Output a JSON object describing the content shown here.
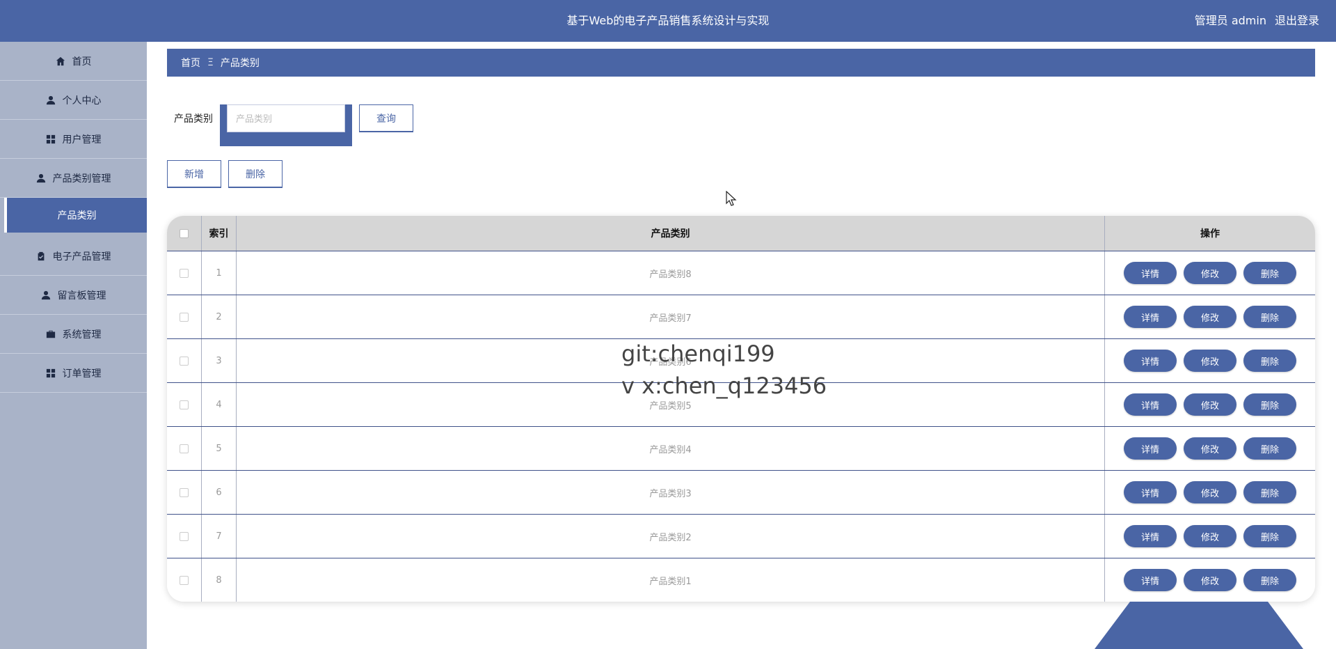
{
  "header": {
    "title": "基于Web的电子产品销售系统设计与实现",
    "user_label": "管理员 admin",
    "logout": "退出登录"
  },
  "sidebar": {
    "items": [
      {
        "label": "首页",
        "icon": "home-icon"
      },
      {
        "label": "个人中心",
        "icon": "user-icon"
      },
      {
        "label": "用户管理",
        "icon": "grid-icon"
      },
      {
        "label": "产品类别管理",
        "icon": "user-icon"
      },
      {
        "label": "产品类别",
        "icon": ""
      },
      {
        "label": "电子产品管理",
        "icon": "clipboard-icon"
      },
      {
        "label": "留言板管理",
        "icon": "user-icon"
      },
      {
        "label": "系统管理",
        "icon": "briefcase-icon"
      },
      {
        "label": "订单管理",
        "icon": "grid-icon"
      }
    ]
  },
  "breadcrumb": {
    "home": "首页",
    "separator": "Ξ",
    "current": "产品类别"
  },
  "search": {
    "label": "产品类别",
    "placeholder": "产品类别",
    "value": "",
    "query_button": "查询"
  },
  "actions": {
    "add": "新增",
    "delete": "删除"
  },
  "table": {
    "headers": {
      "index": "索引",
      "name": "产品类别",
      "op": "操作"
    },
    "rows": [
      {
        "index": "1",
        "name": "产品类别8"
      },
      {
        "index": "2",
        "name": "产品类别7"
      },
      {
        "index": "3",
        "name": "产品类别6"
      },
      {
        "index": "4",
        "name": "产品类别5"
      },
      {
        "index": "5",
        "name": "产品类别4"
      },
      {
        "index": "6",
        "name": "产品类别3"
      },
      {
        "index": "7",
        "name": "产品类别2"
      },
      {
        "index": "8",
        "name": "产品类别1"
      }
    ],
    "row_buttons": {
      "detail": "详情",
      "edit": "修改",
      "delete": "删除"
    }
  },
  "watermark": {
    "line1": "git:chenqi199",
    "line2": "v x:chen_q123456"
  },
  "colors": {
    "primary": "#4a65a5",
    "sidebar_bg": "#a9b3c8",
    "header_row": "#d6d6d6"
  }
}
